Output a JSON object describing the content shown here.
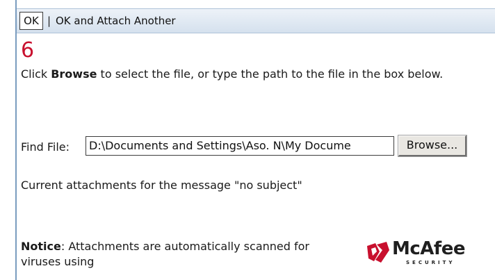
{
  "toolbar": {
    "ok_label": "OK",
    "separator": "|",
    "ok_attach_label": "OK and Attach Another"
  },
  "step": {
    "number": "6"
  },
  "instructions": {
    "prefix": "Click ",
    "bold_word": "Browse",
    "suffix": " to select the file, or type the path to the file in the box below."
  },
  "find_file": {
    "label": "Find File:",
    "value": "D:\\Documents and Settings\\Aso. N\\My Docume",
    "browse_label": "Browse..."
  },
  "attachments": {
    "text": "Current attachments for the message \"no subject\""
  },
  "notice": {
    "label": "Notice",
    "text": ": Attachments are automatically scanned for viruses using"
  },
  "logo": {
    "brand": "McAfee",
    "tagline": "SECURITY"
  },
  "colors": {
    "step_number": "#c8102e",
    "toolbar_top": "#edf2f8",
    "toolbar_bottom": "#d5e1ee",
    "logo_red": "#c8102e"
  }
}
